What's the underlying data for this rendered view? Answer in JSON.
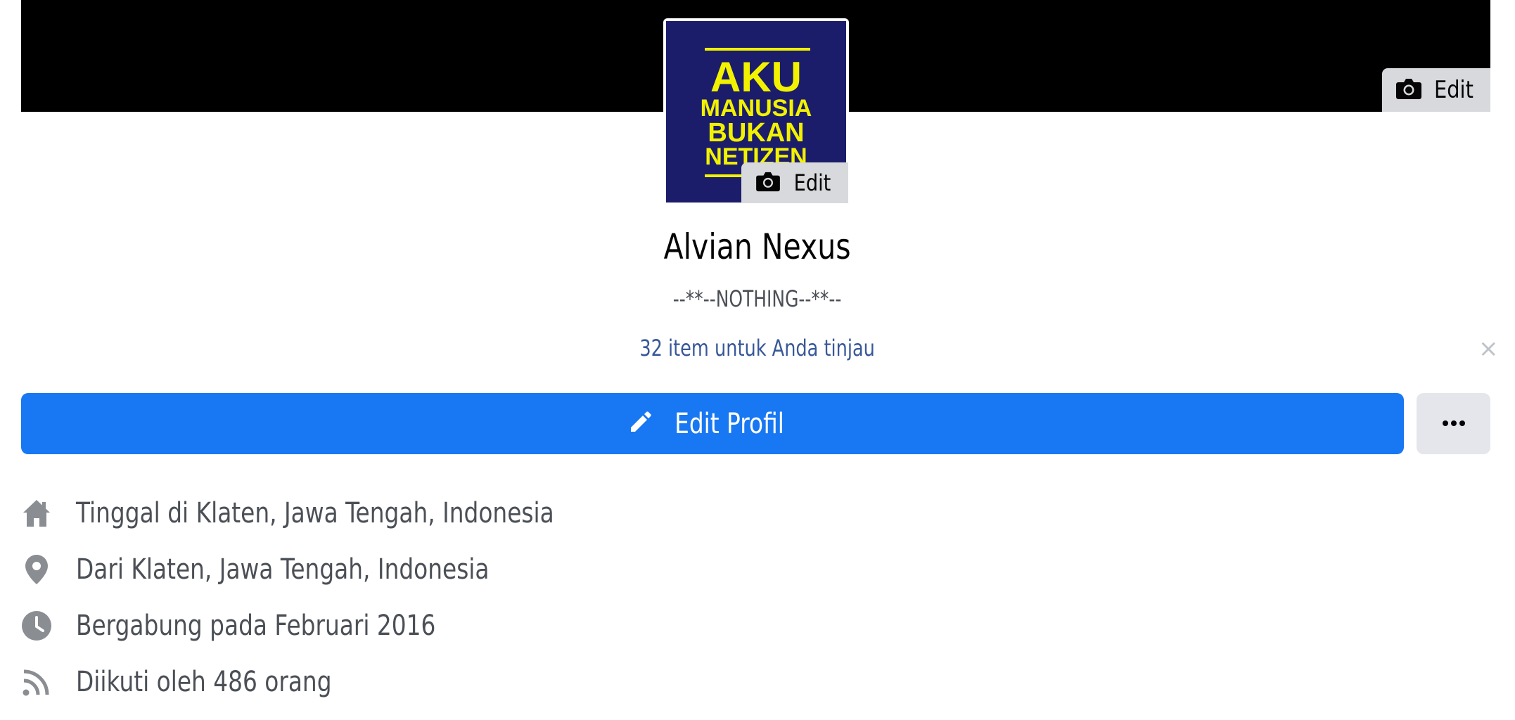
{
  "cover": {
    "edit_label": "Edit"
  },
  "avatar": {
    "image_lines": [
      "AKU",
      "MANUSIA",
      "BUKAN",
      "NETIZEN"
    ],
    "edit_label": "Edit"
  },
  "profile": {
    "name": "Alvian Nexus",
    "bio": "--**--NOTHING--**--",
    "review_link": "32 item untuk Anda tinjau",
    "close_symbol": "×"
  },
  "actions": {
    "edit_profile_label": "Edit Profil",
    "more_label": "..."
  },
  "info": [
    {
      "icon": "home-icon",
      "text": "Tinggal di Klaten, Jawa Tengah, Indonesia"
    },
    {
      "icon": "location-pin-icon",
      "text": "Dari Klaten, Jawa Tengah, Indonesia"
    },
    {
      "icon": "clock-icon",
      "text": "Bergabung pada Februari 2016"
    },
    {
      "icon": "rss-icon",
      "text": "Diikuti oleh 486 orang"
    }
  ],
  "colors": {
    "primary": "#1877f2",
    "link": "#385898",
    "text_secondary": "#4b4f56",
    "icon_gray": "#8a8d91",
    "avatar_bg": "#1b1d6b",
    "avatar_text": "#f2f200"
  }
}
